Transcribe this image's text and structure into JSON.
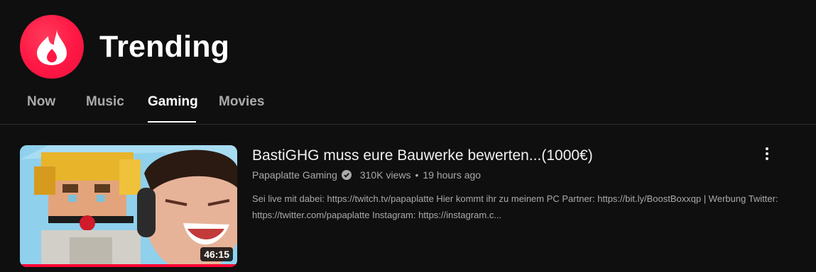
{
  "page": {
    "title": "Trending"
  },
  "logo": {
    "icon": "trending-flame-icon",
    "color": "#ff1744"
  },
  "tabs": [
    {
      "label": "Now",
      "active": false
    },
    {
      "label": "Music",
      "active": false
    },
    {
      "label": "Gaming",
      "active": true
    },
    {
      "label": "Movies",
      "active": false
    }
  ],
  "video": {
    "title": "BastiGHG muss eure Bauwerke bewerten...(1000€)",
    "channel": "Papaplatte Gaming",
    "verified": true,
    "views": "310K views",
    "separator": "•",
    "age": "19 hours ago",
    "description": "Sei live mit dabei: https://twitch.tv/papaplatte Hier kommt ihr zu meinem PC Partner: https://bit.ly/BoostBoxxqp | Werbung Twitter: https://twitter.com/papaplatte Instagram: https://instagram.c...",
    "duration": "46:15",
    "watched_fraction": 1.0,
    "progress_color": "#ff0033",
    "menu_icon": "more-vert-icon"
  }
}
